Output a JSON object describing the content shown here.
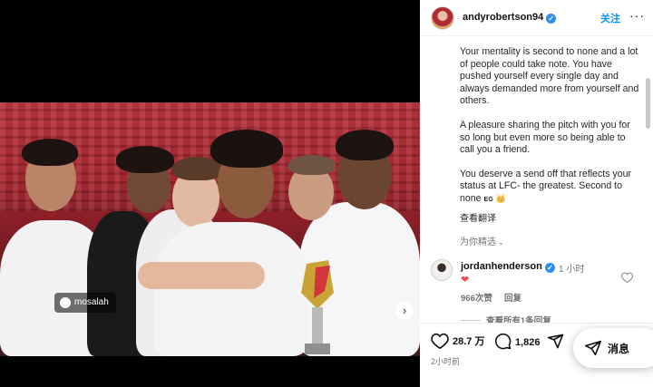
{
  "media": {
    "photo_tag": "mosalah",
    "next_arrow": "›"
  },
  "header": {
    "username": "andyrobertson94",
    "verified_mark": "✓",
    "follow_label": "关注",
    "more_label": "···"
  },
  "caption": {
    "paragraphs": [
      "Your mentality is second to none and a lot of people could take note. You have pushed yourself every single day and always demanded more from yourself and others.",
      "A pleasure sharing the pitch with you for so long but even more so being able to call you a friend.",
      "You deserve a send off that reflects your status at LFC- the greatest. Second to none"
    ],
    "initials": "EG",
    "crown": "👑",
    "translate_label": "查看翻译"
  },
  "comments_filter": {
    "label": "为你精选",
    "chevron": "⌄"
  },
  "comment": {
    "username": "jordanhenderson",
    "verified_mark": "✓",
    "time": "1 小时",
    "text": "❤",
    "likes": "966次赞",
    "reply_label": "回复",
    "view_replies": "查看所有1条回复"
  },
  "actions": {
    "likes_count": "28.7 万",
    "comments_count": "1,826",
    "posted_time": "2小时前"
  },
  "messages_button": {
    "label": "消息"
  }
}
